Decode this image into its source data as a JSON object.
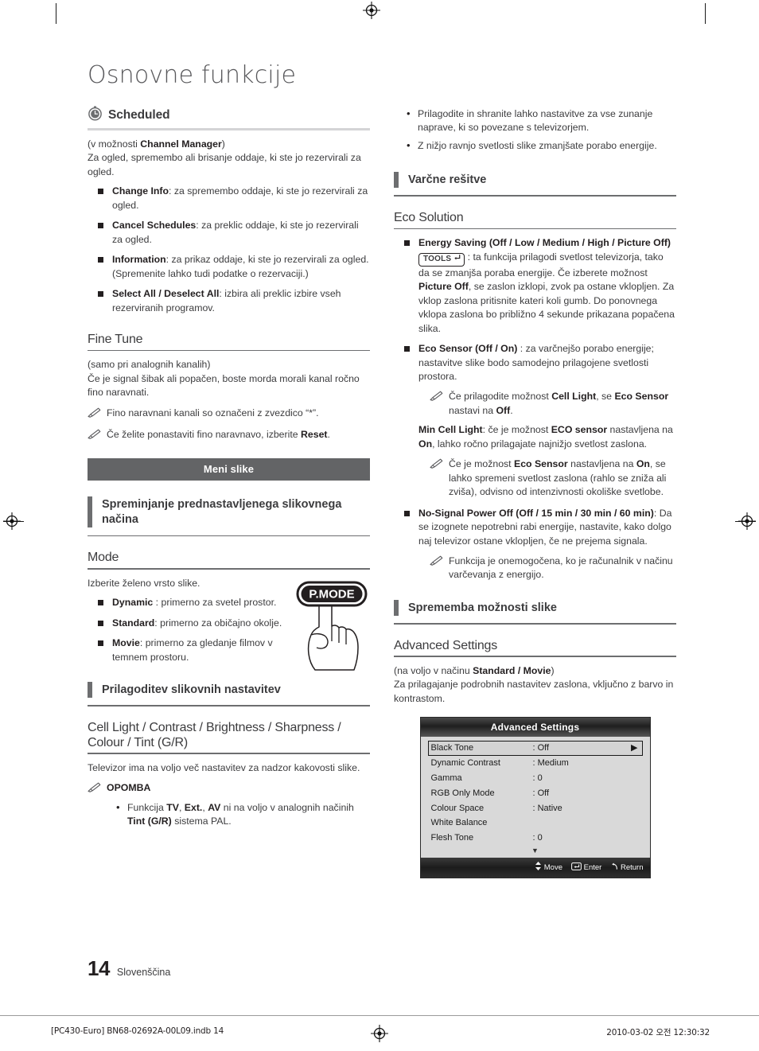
{
  "page": {
    "chapter_title": "Osnovne funkcije",
    "folio_number": "14",
    "folio_language": "Slovenščina",
    "print_left": "[PC430-Euro] BN68-02692A-00L09.indb   14",
    "print_right": "2010-03-02   오전 12:30:32"
  },
  "left_column": {
    "scheduled": {
      "icon": "clock-icon",
      "title": "Scheduled",
      "intro_1_pre": "(v možnosti ",
      "intro_1_bold": "Channel Manager",
      "intro_1_post": ")",
      "intro_2": "Za ogled, spremembo ali brisanje oddaje, ki ste jo rezervirali za ogled.",
      "bullets": [
        {
          "term": "Change Info",
          "text": ": za spremembo oddaje, ki ste jo rezervirali za ogled."
        },
        {
          "term": "Cancel Schedules",
          "text": ": za preklic oddaje, ki ste jo rezervirali za ogled."
        },
        {
          "term": "Information",
          "text": ": za prikaz oddaje, ki ste jo rezervirali za ogled. (Spremenite lahko tudi podatke o rezervaciji.)"
        },
        {
          "term": "Select All / Deselect All",
          "text": ": izbira ali preklic izbire vseh rezerviranih programov."
        }
      ]
    },
    "fine_tune": {
      "title": "Fine Tune",
      "intro_1": "(samo pri analognih kanalih)",
      "intro_2": "Če je signal šibak ali popačen, boste morda morali kanal ročno fino naravnati.",
      "note_1": "Fino naravnani kanali so označeni z zvezdico “*”.",
      "note_2_pre": "Če želite ponastaviti fino naravnavo, izberite ",
      "note_2_bold": "Reset",
      "note_2_post": "."
    },
    "banner": "Meni slike",
    "preset_heading": "Spreminjanje prednastavljenega slikovnega načina",
    "mode": {
      "title": "Mode",
      "intro": "Izberite želeno vrsto slike.",
      "button_label": "P.MODE",
      "bullets": [
        {
          "term": "Dynamic",
          "text": " : primerno za svetel prostor."
        },
        {
          "term": "Standard",
          "text": ": primerno za običajno okolje."
        },
        {
          "term": "Movie",
          "text": ": primerno za gledanje filmov v temnem prostoru."
        }
      ]
    },
    "adjust_heading": "Prilagoditev slikovnih nastavitev",
    "cell_light": {
      "title": "Cell Light / Contrast / Brightness / Sharpness / Colour / Tint (G/R)",
      "intro": "Televizor ima na voljo več nastavitev za nadzor kakovosti slike.",
      "note_label": "OPOMBA",
      "note_bullet_1_a": "Funkcija ",
      "note_bullet_1_b": "TV",
      "note_bullet_1_c": ", ",
      "note_bullet_1_d": "Ext.",
      "note_bullet_1_e": ", ",
      "note_bullet_1_f": "AV",
      "note_bullet_1_g": " ni na voljo v analognih načinih ",
      "note_bullet_1_h": "Tint (G/R)",
      "note_bullet_1_i": " sistema PAL."
    }
  },
  "right_column": {
    "top_bullets": [
      "Prilagodite in shranite lahko nastavitve za vse zunanje naprave, ki so povezane s televizorjem.",
      "Z nižjo ravnjo svetlosti slike zmanjšate porabo energije."
    ],
    "eco_heading": "Varčne rešitve",
    "eco_solution": {
      "title": "Eco Solution",
      "energy_saving": {
        "term": "Energy Saving (Off / Low / Medium / High / Picture Off)",
        "tools_label": "TOOLS",
        "text_a": " : ta funkcija prilagodi svetlost televizorja, tako da se zmanjša poraba energije. Če izberete možnost ",
        "text_b": "Picture Off",
        "text_c": ", se zaslon izklopi, zvok pa ostane vklopljen. Za vklop zaslona pritisnite kateri koli gumb. Do ponovnega vklopa zaslona bo približno 4 sekunde prikazana popačena slika."
      },
      "eco_sensor": {
        "term": "Eco Sensor (Off / On)",
        "text": " : za varčnejšo porabo energije; nastavitve slike bodo samodejno prilagojene svetlosti prostora.",
        "note_a": "Če prilagodite možnost ",
        "note_b": "Cell Light",
        "note_c": ", se ",
        "note_d": "Eco Sensor",
        "note_e": " nastavi na ",
        "note_f": "Off",
        "note_g": "."
      },
      "min_cell_light": {
        "term": "Min Cell Light",
        "text_a": ": če je možnost ",
        "text_b": "ECO sensor",
        "text_c": " nastavljena na ",
        "text_d": "On",
        "text_e": ", lahko ročno prilagajate najnižjo svetlost zaslona.",
        "note_a": "Če je možnost ",
        "note_b": "Eco Sensor",
        "note_c": " nastavljena na ",
        "note_d": "On",
        "note_e": ", se lahko spremeni svetlost zaslona (rahlo se zniža ali zviša), odvisno od intenzivnosti okoliške svetlobe."
      },
      "no_signal": {
        "term": "No-Signal Power Off (Off / 15 min / 30 min / 60 min)",
        "text": ": Da se izognete nepotrebni rabi energije, nastavite, kako dolgo naj televizor ostane vklopljen, če ne prejema signala.",
        "note": "Funkcija je onemogočena, ko je računalnik v načinu varčevanja z energijo."
      }
    },
    "picture_options_heading": "Sprememba možnosti slike",
    "advanced_settings": {
      "title": "Advanced Settings",
      "intro_1_pre": "(na voljo v načinu ",
      "intro_1_bold": "Standard / Movie",
      "intro_1_post": ")",
      "intro_2": "Za prilagajanje podrobnih nastavitev zaslona, vključno z barvo in kontrastom.",
      "osd": {
        "title": "Advanced Settings",
        "rows": [
          {
            "label": "Black Tone",
            "value": ": Off",
            "selected": true,
            "arrow": "▶"
          },
          {
            "label": "Dynamic Contrast",
            "value": ": Medium",
            "selected": false,
            "arrow": ""
          },
          {
            "label": "Gamma",
            "value": ": 0",
            "selected": false,
            "arrow": ""
          },
          {
            "label": "RGB Only Mode",
            "value": ": Off",
            "selected": false,
            "arrow": ""
          },
          {
            "label": "Colour Space",
            "value": ": Native",
            "selected": false,
            "arrow": ""
          },
          {
            "label": "White Balance",
            "value": "",
            "selected": false,
            "arrow": ""
          },
          {
            "label": "Flesh Tone",
            "value": ": 0",
            "selected": false,
            "arrow": ""
          }
        ],
        "scroll_indicator": "▼",
        "footer": {
          "move": "Move",
          "enter": "Enter",
          "return": "Return"
        }
      }
    }
  }
}
